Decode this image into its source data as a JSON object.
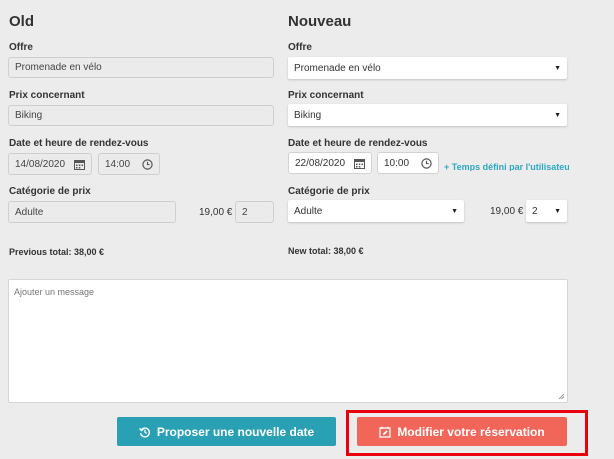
{
  "old": {
    "title": "Old",
    "offer_label": "Offre",
    "offer_value": "Promenade en vélo",
    "concern_label": "Prix concernant",
    "concern_value": "Biking",
    "datetime_label": "Date et heure de rendez-vous",
    "date_value": "14/08/2020",
    "time_value": "14:00",
    "category_label": "Catégorie de prix",
    "category_value": "Adulte",
    "unit_price": "19,00 €",
    "quantity": "2",
    "total": "Previous total: 38,00 €"
  },
  "new": {
    "title": "Nouveau",
    "offer_label": "Offre",
    "offer_value": "Promenade en vélo",
    "concern_label": "Prix concernant",
    "concern_value": "Biking",
    "datetime_label": "Date et heure de rendez-vous",
    "date_value": "22/08/2020",
    "time_value": "10:00",
    "time_link": "+ Temps défini par l'utilisateur",
    "category_label": "Catégorie de prix",
    "category_value": "Adulte",
    "unit_price": "19,00 €",
    "quantity": "2",
    "total": "New total: 38,00 €"
  },
  "message": {
    "placeholder": "Ajouter un message"
  },
  "buttons": {
    "propose_label": "Proposer une nouvelle date",
    "modify_label": "Modifier votre réservation"
  },
  "colors": {
    "teal": "#2aa0b5",
    "salmon": "#f2665a",
    "highlight": "#e8000e",
    "link": "#2ea8c0"
  },
  "icons": {
    "calendar": "calendar-icon",
    "clock": "clock-icon",
    "caret": "caret-down-icon",
    "history": "history-icon",
    "edit": "edit-calendar-icon"
  }
}
